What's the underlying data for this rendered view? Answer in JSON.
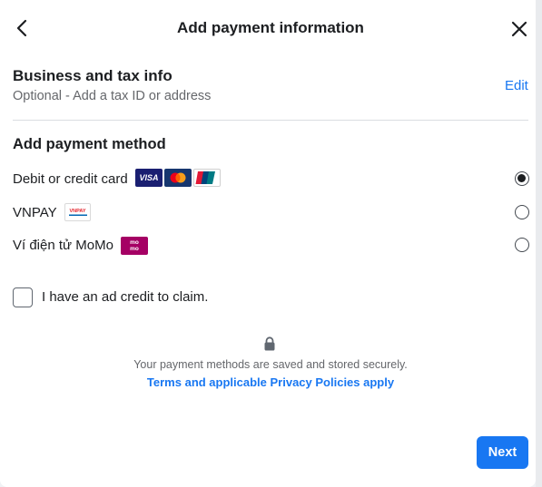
{
  "dialog": {
    "title": "Add payment information",
    "back_icon": "chevron-left-icon",
    "close_icon": "close-icon"
  },
  "business": {
    "title": "Business and tax info",
    "subtitle": "Optional - Add a tax ID or address",
    "edit_label": "Edit"
  },
  "payment": {
    "title": "Add payment method",
    "selected": "Debit or credit card",
    "methods": [
      {
        "label": "Debit or credit card",
        "logos": [
          "visa-logo",
          "mastercard-logo",
          "unionpay-logo"
        ],
        "checked": true
      },
      {
        "label": "VNPAY",
        "logos": [
          "vnpay-logo"
        ],
        "logo_text": "VNPAY",
        "checked": false
      },
      {
        "label": "Ví điện tử MoMo",
        "logos": [
          "momo-logo"
        ],
        "logo_text_top": "mo",
        "logo_text_bottom": "mo",
        "checked": false
      }
    ],
    "visa_text": "VISA"
  },
  "ad_credit": {
    "label": "I have an ad credit to claim.",
    "checked": false
  },
  "footer": {
    "lock_icon": "lock-icon",
    "secure_text": "Your payment methods are saved and stored securely.",
    "terms_link": "Terms and applicable Privacy Policies apply",
    "next_label": "Next"
  },
  "colors": {
    "accent": "#1877f2",
    "text_primary": "#1c1e21",
    "text_secondary": "#65676b",
    "divider": "#dadde1",
    "momo": "#a50064",
    "visa": "#1a1f71"
  }
}
